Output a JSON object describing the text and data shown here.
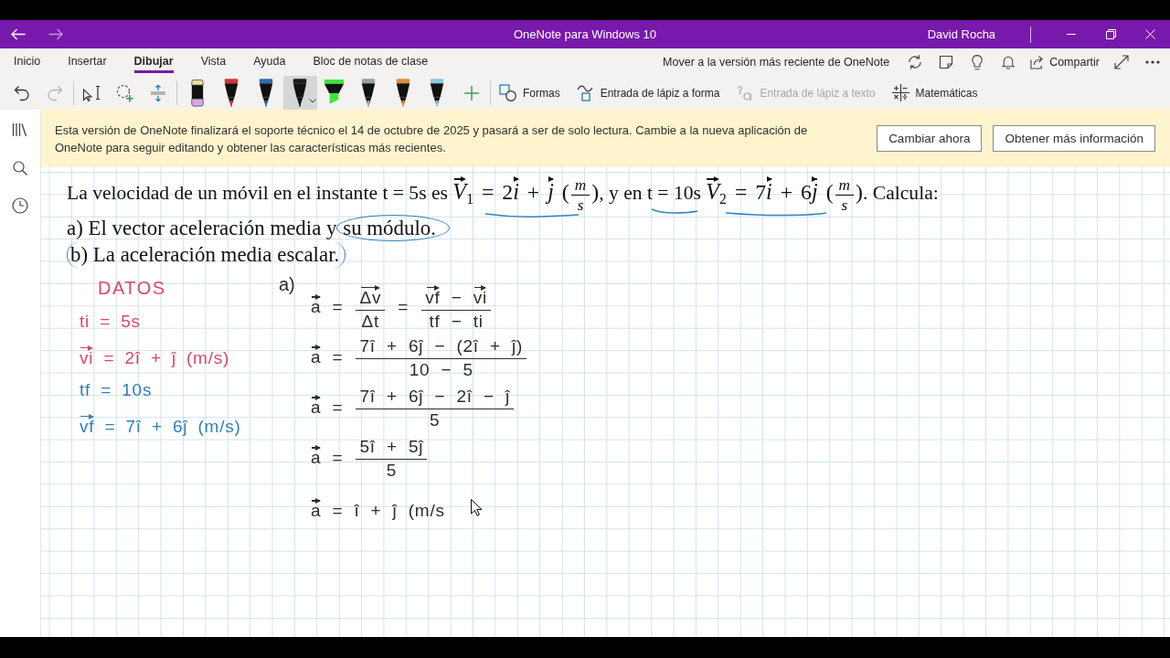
{
  "window": {
    "title": "OneNote para Windows 10",
    "user": "David Rocha"
  },
  "nav": [
    {
      "kind": "back",
      "disabled": false
    },
    {
      "kind": "forward",
      "disabled": true
    }
  ],
  "ribbon": {
    "tabs": [
      {
        "label": "Inicio",
        "selected": false
      },
      {
        "label": "Insertar",
        "selected": false
      },
      {
        "label": "Dibujar",
        "selected": true
      },
      {
        "label": "Vista",
        "selected": false
      },
      {
        "label": "Ayuda",
        "selected": false
      },
      {
        "label": "Bloc de notas de clase",
        "selected": false
      }
    ],
    "update_link": "Mover a la versión más reciente de OneNote",
    "share": "Compartir"
  },
  "toolbar": {
    "history": [
      {
        "kind": "undo",
        "disabled": false
      },
      {
        "kind": "redo",
        "disabled": true
      }
    ],
    "pens": [
      {
        "kind": "eraser",
        "selected": false
      },
      {
        "kind": "pen",
        "color": "#d13438",
        "selected": false
      },
      {
        "kind": "pen",
        "color": "#2c6fad",
        "selected": false
      },
      {
        "kind": "pen",
        "color": "#1b1b1b",
        "selected": true
      },
      {
        "kind": "highlighter",
        "color": "#3ce63c",
        "selected": false
      },
      {
        "kind": "pen",
        "color": "#9e9e9e",
        "selected": false
      },
      {
        "kind": "pen",
        "color": "#e48a3c",
        "selected": false
      },
      {
        "kind": "pen",
        "color": "#86c8e6",
        "selected": false
      }
    ],
    "actions": [
      {
        "kind": "shapes",
        "label": "Formas",
        "disabled": false
      },
      {
        "kind": "ink-to-shape",
        "label": "Entrada de lápiz a forma",
        "disabled": false
      },
      {
        "kind": "ink-to-text",
        "label": "Entrada de lápiz a texto",
        "disabled": true
      },
      {
        "kind": "math",
        "label": "Matemáticas",
        "disabled": false
      }
    ]
  },
  "banner": {
    "message": "Esta versión de OneNote finalizará el soporte técnico el 14 de octubre de 2025 y pasará a ser de solo lectura. Cambie a la nueva aplicación de OneNote para seguir editando y obtener las características más recientes.",
    "buttons": [
      "Cambiar ahora",
      "Obtener más información"
    ]
  },
  "page": {
    "question": {
      "statement": [
        {
          "kind": "txt",
          "text": "La velocidad de un móvil en el instante t = 5s es "
        },
        {
          "kind": "vec",
          "text": "V",
          "sub": "1"
        },
        {
          "kind": "mathup",
          "text": " = 2"
        },
        {
          "kind": "vec",
          "text": "i"
        },
        {
          "kind": "mathup",
          "text": " + "
        },
        {
          "kind": "vec",
          "text": "j"
        },
        {
          "kind": "mathup",
          "text": " ("
        },
        {
          "kind": "frac",
          "num": [
            {
              "kind": "math",
              "text": "m"
            }
          ],
          "den": [
            {
              "kind": "math",
              "text": "s"
            }
          ]
        },
        {
          "kind": "mathup",
          "text": ")"
        },
        {
          "kind": "txt",
          "text": ", y en t = 10s "
        },
        {
          "kind": "vec",
          "text": "V",
          "sub": "2"
        },
        {
          "kind": "mathup",
          "text": " = 7"
        },
        {
          "kind": "vec",
          "text": "i"
        },
        {
          "kind": "mathup",
          "text": " + 6"
        },
        {
          "kind": "vec",
          "text": "j"
        },
        {
          "kind": "mathup",
          "text": " ("
        },
        {
          "kind": "frac",
          "num": [
            {
              "kind": "math",
              "text": "m"
            }
          ],
          "den": [
            {
              "kind": "math",
              "text": "s"
            }
          ]
        },
        {
          "kind": "mathup",
          "text": ")"
        },
        {
          "kind": "txt",
          "text": ". Calcula:"
        }
      ],
      "items": [
        {
          "parts": [
            {
              "kind": "plain",
              "text": "a) El vector aceleración media y "
            },
            {
              "kind": "circled",
              "text": "su módulo."
            }
          ]
        },
        {
          "parts": [
            {
              "kind": "bracketed",
              "text": "b) La aceleración media escalar."
            }
          ]
        }
      ]
    },
    "notes": {
      "heading": "DATOS",
      "lines": [
        {
          "color": "#dc4862",
          "tokens": [
            {
              "kind": "txt",
              "text": "ti = 5s"
            }
          ]
        },
        {
          "color": "#dc4862",
          "tokens": [
            {
              "kind": "vec",
              "text": "vi"
            },
            {
              "kind": "txt",
              "text": " = 2î + ĵ (m/s)"
            }
          ]
        },
        {
          "color": "#2f7fb5",
          "tokens": [
            {
              "kind": "txt",
              "text": "tf = 10s"
            }
          ]
        },
        {
          "color": "#2f7fb5",
          "tokens": [
            {
              "kind": "vec",
              "text": "vf"
            },
            {
              "kind": "txt",
              "text": " = 7î + 6ĵ (m/s)"
            }
          ]
        }
      ]
    },
    "solution": {
      "label": "a)",
      "lines": [
        [
          {
            "kind": "vec",
            "text": "a"
          },
          {
            "kind": "txt",
            "text": " = "
          },
          {
            "kind": "frac",
            "num": [
              {
                "kind": "vec",
                "text": "Δv"
              }
            ],
            "den": [
              {
                "kind": "txt",
                "text": "Δt"
              }
            ]
          },
          {
            "kind": "txt",
            "text": " = "
          },
          {
            "kind": "frac",
            "num": [
              {
                "kind": "vec",
                "text": "vf"
              },
              {
                "kind": "txt",
                "text": " − "
              },
              {
                "kind": "vec",
                "text": "vi"
              }
            ],
            "den": [
              {
                "kind": "txt",
                "text": "tf − ti"
              }
            ]
          }
        ],
        [
          {
            "kind": "vec",
            "text": "a"
          },
          {
            "kind": "txt",
            "text": " = "
          },
          {
            "kind": "frac",
            "num": [
              {
                "kind": "txt",
                "text": "7î + 6ĵ − (2î + ĵ)"
              }
            ],
            "den": [
              {
                "kind": "txt",
                "text": "10 − 5"
              }
            ]
          }
        ],
        [
          {
            "kind": "vec",
            "text": "a"
          },
          {
            "kind": "txt",
            "text": " = "
          },
          {
            "kind": "frac",
            "num": [
              {
                "kind": "txt",
                "text": "7î + 6ĵ − 2î − ĵ"
              }
            ],
            "den": [
              {
                "kind": "txt",
                "text": "5"
              }
            ]
          }
        ],
        [
          {
            "kind": "vec",
            "text": "a"
          },
          {
            "kind": "txt",
            "text": " = "
          },
          {
            "kind": "frac",
            "num": [
              {
                "kind": "txt",
                "text": "5î + 5ĵ"
              }
            ],
            "den": [
              {
                "kind": "txt",
                "text": "5"
              }
            ]
          }
        ],
        [
          {
            "kind": "vec",
            "text": "a"
          },
          {
            "kind": "txt",
            "text": " = î + ĵ (m/s"
          }
        ]
      ]
    }
  }
}
